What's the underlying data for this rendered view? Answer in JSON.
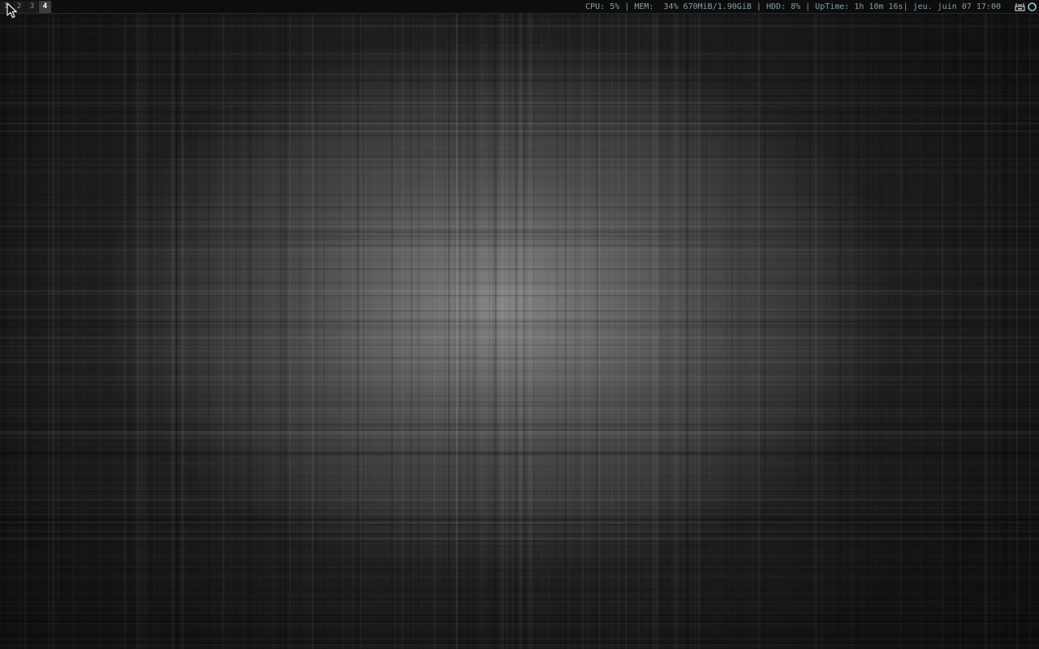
{
  "workspaces": [
    {
      "label": "1",
      "active": false
    },
    {
      "label": "2",
      "active": false
    },
    {
      "label": "3",
      "active": false
    },
    {
      "label": "4",
      "active": true
    }
  ],
  "status": {
    "cpu_label": "CPU:",
    "cpu_value": "5%",
    "mem_label": "MEM:",
    "mem_value": "34% 670MiB/1.90GiB",
    "hdd_label": "HDD:",
    "hdd_value": "8%",
    "uptime_label": "UpTime:",
    "uptime_value": "1h 10m 16s",
    "datetime": "jeu. juin 07 17:00"
  },
  "tray": {
    "icons": [
      "network-icon",
      "update-icon"
    ]
  },
  "colors": {
    "bar_bg": "#0d0d0d",
    "status_text": "#7fa0aa",
    "active_workspace": "#3c3c3c"
  }
}
